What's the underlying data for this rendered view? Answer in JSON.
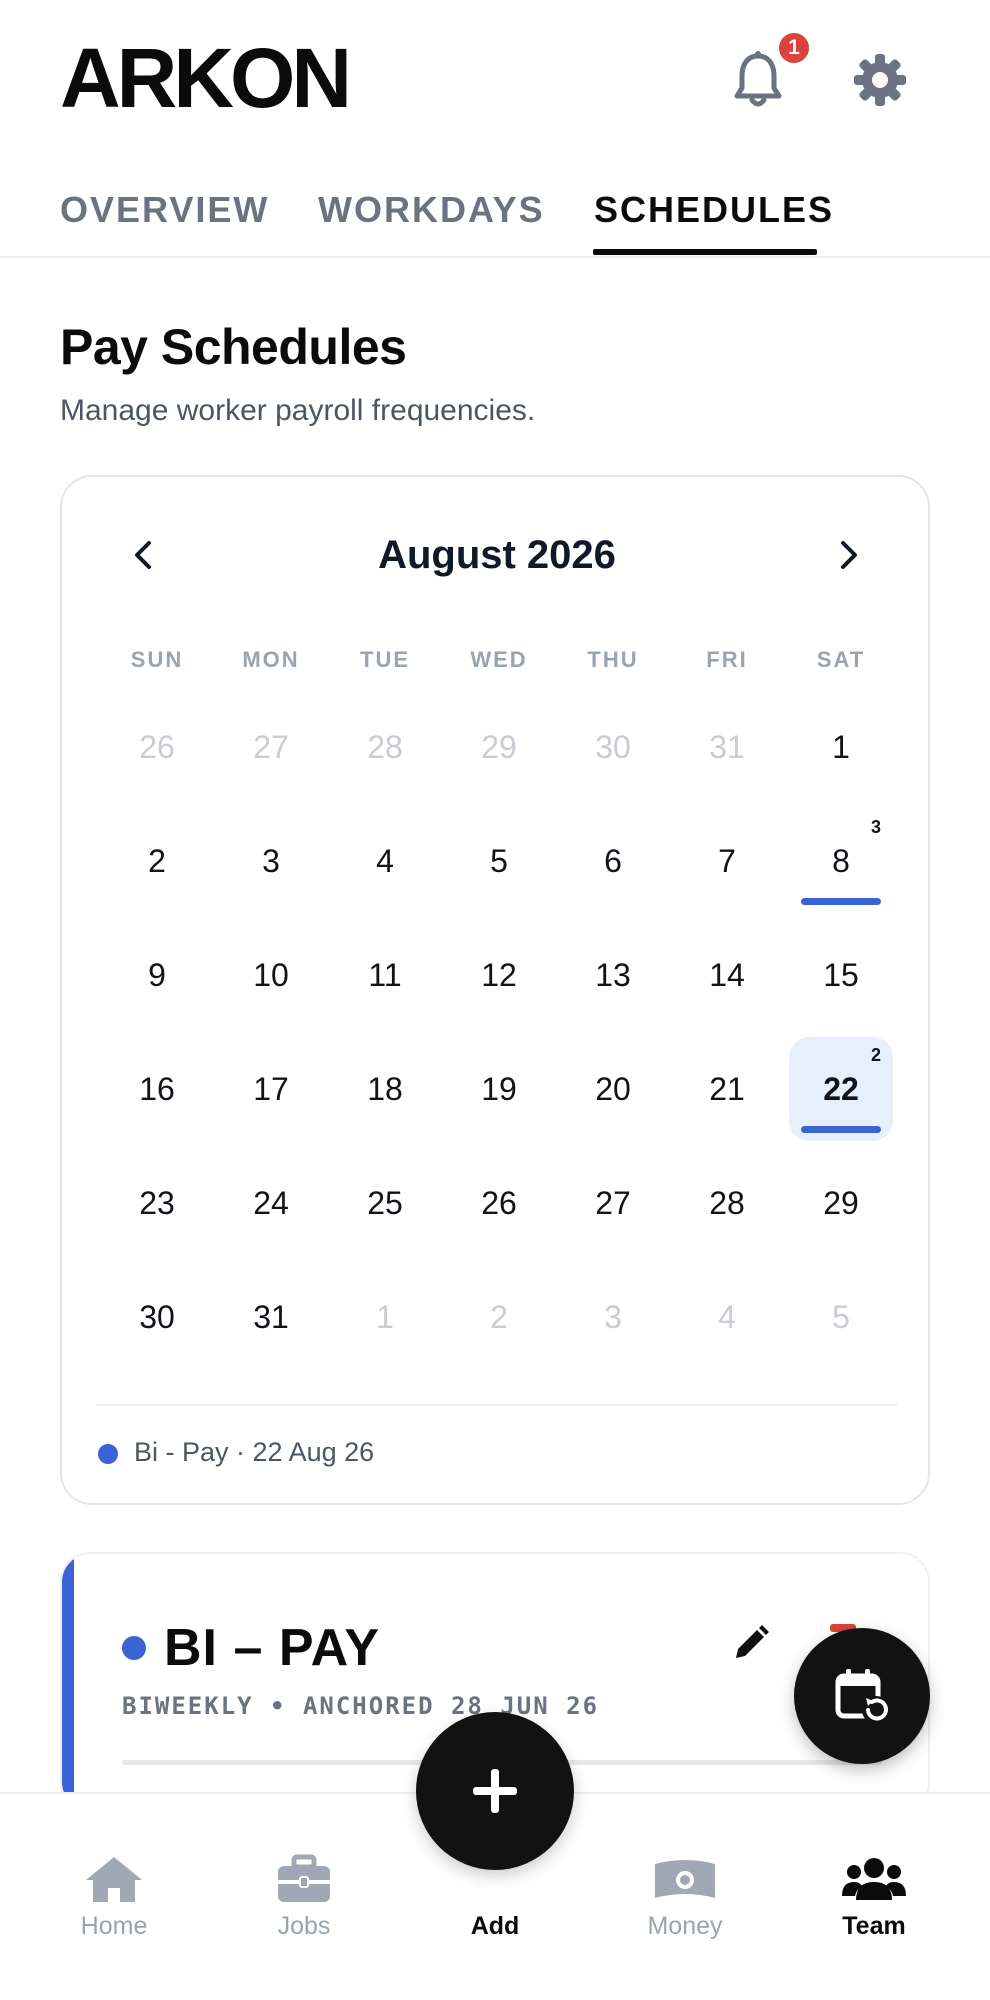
{
  "app": {
    "logo": "ARKON"
  },
  "header": {
    "notification_count": "1"
  },
  "tabs": [
    {
      "label": "OVERVIEW",
      "active": false
    },
    {
      "label": "WORKDAYS",
      "active": false
    },
    {
      "label": "SCHEDULES",
      "active": true
    }
  ],
  "page": {
    "title": "Pay Schedules",
    "subtitle": "Manage worker payroll frequencies."
  },
  "calendar": {
    "month_label": "August 2026",
    "weekdays": [
      "SUN",
      "MON",
      "TUE",
      "WED",
      "THU",
      "FRI",
      "SAT"
    ],
    "weeks": [
      [
        {
          "d": "26",
          "muted": true
        },
        {
          "d": "27",
          "muted": true
        },
        {
          "d": "28",
          "muted": true
        },
        {
          "d": "29",
          "muted": true
        },
        {
          "d": "30",
          "muted": true
        },
        {
          "d": "31",
          "muted": true
        },
        {
          "d": "1"
        }
      ],
      [
        {
          "d": "2"
        },
        {
          "d": "3"
        },
        {
          "d": "4"
        },
        {
          "d": "5"
        },
        {
          "d": "6"
        },
        {
          "d": "7"
        },
        {
          "d": "8",
          "count": "3",
          "marked": true
        }
      ],
      [
        {
          "d": "9"
        },
        {
          "d": "10"
        },
        {
          "d": "11"
        },
        {
          "d": "12"
        },
        {
          "d": "13"
        },
        {
          "d": "14"
        },
        {
          "d": "15"
        }
      ],
      [
        {
          "d": "16"
        },
        {
          "d": "17"
        },
        {
          "d": "18"
        },
        {
          "d": "19"
        },
        {
          "d": "20"
        },
        {
          "d": "21"
        },
        {
          "d": "22",
          "count": "2",
          "marked": true,
          "selected": true
        }
      ],
      [
        {
          "d": "23"
        },
        {
          "d": "24"
        },
        {
          "d": "25"
        },
        {
          "d": "26"
        },
        {
          "d": "27"
        },
        {
          "d": "28"
        },
        {
          "d": "29"
        }
      ],
      [
        {
          "d": "30"
        },
        {
          "d": "31"
        },
        {
          "d": "1",
          "muted": true
        },
        {
          "d": "2",
          "muted": true
        },
        {
          "d": "3",
          "muted": true
        },
        {
          "d": "4",
          "muted": true
        },
        {
          "d": "5",
          "muted": true
        }
      ]
    ],
    "legend": "Bi - Pay · 22 Aug 26",
    "marker_color": "#3a63d8"
  },
  "schedule": {
    "name": "BI – PAY",
    "meta": "BIWEEKLY • ANCHORED 28 JUN 26",
    "accent_color": "#3a63d8"
  },
  "bottom_nav": [
    {
      "label": "Home",
      "icon": "home-icon"
    },
    {
      "label": "Jobs",
      "icon": "briefcase-icon"
    },
    {
      "label": "Add",
      "icon": "plus-icon"
    },
    {
      "label": "Money",
      "icon": "money-icon"
    },
    {
      "label": "Team",
      "icon": "team-icon",
      "active": true
    }
  ]
}
